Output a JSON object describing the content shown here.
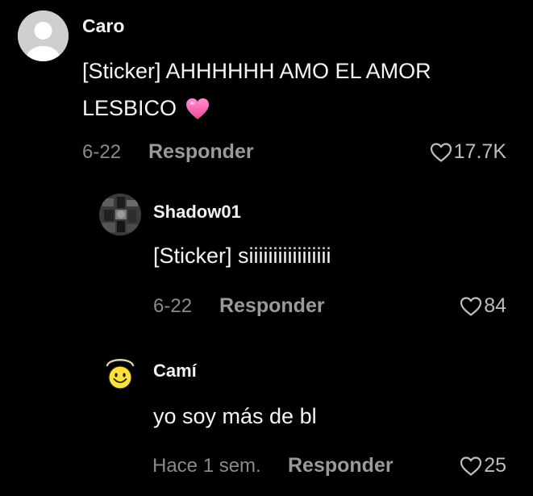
{
  "comments": [
    {
      "username": "Caro",
      "text_line1": "[Sticker] AHHHHHH AMO EL AMOR",
      "text_line2": "LESBICO",
      "emoji": "pink-heart-emoji",
      "date": "6-22",
      "reply_label": "Responder",
      "likes": "17.7K",
      "avatar": "default-avatar"
    },
    {
      "username": "Shadow01",
      "text": "[Sticker] siiiiiiiiiiiiiiiii",
      "date": "6-22",
      "reply_label": "Responder",
      "likes": "84",
      "avatar": "shadow-avatar"
    },
    {
      "username": "Camí",
      "text": "yo soy más de bl",
      "date": "Hace 1 sem.",
      "reply_label": "Responder",
      "likes": "25",
      "avatar": "smiley-halo-avatar"
    }
  ],
  "colors": {
    "background": "#000000",
    "primary_text": "#f5f5f5",
    "secondary_text": "#8a8a8a",
    "heart_emoji": "#ff5fb0"
  }
}
